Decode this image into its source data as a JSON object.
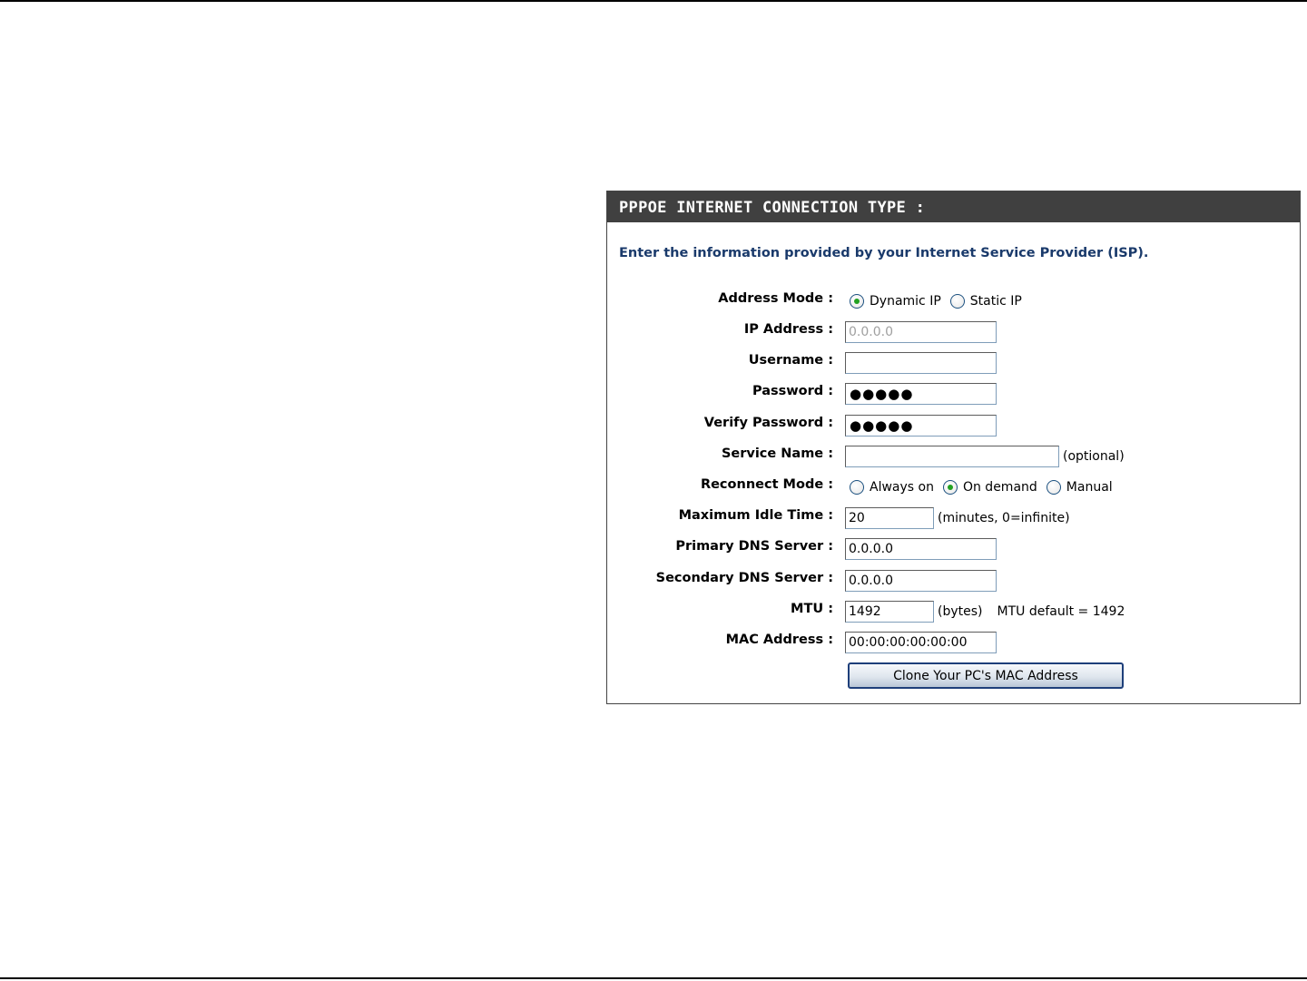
{
  "panel": {
    "title": "PPPOE INTERNET CONNECTION TYPE :",
    "intro": "Enter the information provided by your Internet Service Provider (ISP)."
  },
  "form": {
    "address_mode": {
      "label": "Address Mode :",
      "options": [
        "Dynamic IP",
        "Static IP"
      ],
      "selected": "Dynamic IP"
    },
    "ip_address": {
      "label": "IP Address :",
      "value": "0.0.0.0"
    },
    "username": {
      "label": "Username :",
      "value": ""
    },
    "password": {
      "label": "Password :",
      "masked": "●●●●●"
    },
    "verify_password": {
      "label": "Verify Password :",
      "masked": "●●●●●"
    },
    "service_name": {
      "label": "Service Name :",
      "value": "",
      "suffix": "(optional)"
    },
    "reconnect_mode": {
      "label": "Reconnect Mode :",
      "options": [
        "Always on",
        "On demand",
        "Manual"
      ],
      "selected": "On demand"
    },
    "max_idle_time": {
      "label": "Maximum Idle Time :",
      "value": "20",
      "suffix": "(minutes, 0=infinite)"
    },
    "primary_dns": {
      "label": "Primary DNS Server :",
      "value": "0.0.0.0"
    },
    "secondary_dns": {
      "label": "Secondary DNS Server :",
      "value": "0.0.0.0"
    },
    "mtu": {
      "label": "MTU :",
      "value": "1492",
      "suffix": "(bytes)",
      "default_text": "MTU default = 1492"
    },
    "mac_address": {
      "label": "MAC Address :",
      "value": "00:00:00:00:00:00"
    },
    "clone_button": "Clone Your PC's MAC Address"
  },
  "colors": {
    "header_bg": "#404040",
    "intro_text": "#1a3a6b",
    "radio_dot": "#21a121",
    "button_border": "#1e3f7a"
  }
}
